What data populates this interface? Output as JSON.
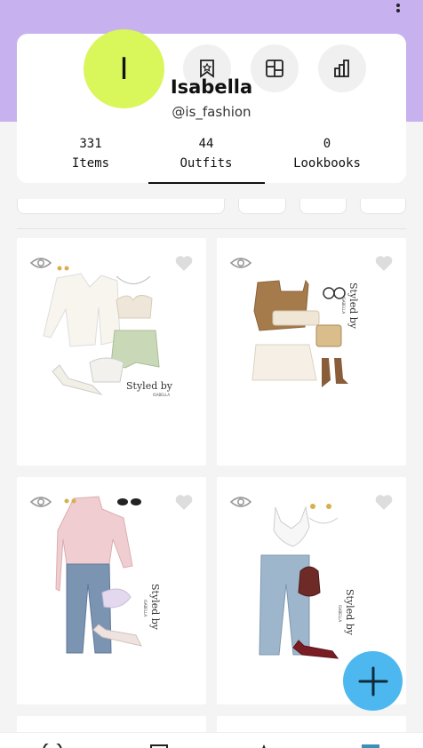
{
  "profile": {
    "avatar_initial": "I",
    "name": "Isabella",
    "handle": "@is_fashion",
    "stats": [
      {
        "count": "331",
        "label": "Items"
      },
      {
        "count": "44",
        "label": "Outfits"
      },
      {
        "count": "0",
        "label": "Lookbooks"
      }
    ],
    "active_tab": "Outfits"
  },
  "actions": {
    "icons": [
      "bookmark-icon",
      "layout-grid-icon",
      "bar-chart-icon"
    ]
  },
  "outfits": [
    {
      "styled_text": "Styled by",
      "sub": "ISABELLA"
    },
    {
      "styled_text": "Styled by",
      "sub": "ISABELLA"
    },
    {
      "styled_text": "Styled by",
      "sub": "ISABELLA"
    },
    {
      "styled_text": "Styled by",
      "sub": "ISABELLA"
    }
  ],
  "colors": {
    "header": "#c7b2ef",
    "avatar": "#d9f65a",
    "fab": "#4db8ef"
  }
}
